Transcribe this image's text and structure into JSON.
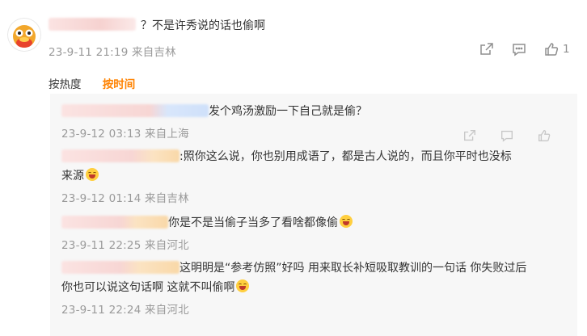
{
  "main_comment": {
    "text": "？不是许秀说的话也偷啊",
    "meta": "23-9-11 21:19 来自吉林",
    "likes": "1"
  },
  "sort_tabs": {
    "by_hot": "按热度",
    "by_time": "按时间"
  },
  "replies": [
    {
      "text": "发个鸡汤激励一下自己就是偷？",
      "meta": "23-9-12 03:13 来自上海"
    },
    {
      "text_line1": ":照你这么说，你也别用成语了，都是古人说的，而且你平时也没标",
      "text_line2": "来源",
      "meta": "23-9-12 01:14 来自吉林"
    },
    {
      "text": "你是不是当偷子当多了看啥都像偷",
      "meta": "23-9-11 22:25 来自河北"
    },
    {
      "text_line1": "这明明是“参考仿照”好吗 用来取长补短吸取教训的一句话 你失败过后",
      "text_line2": "你也可以说这句话啊 这就不叫偷啊",
      "meta": "23-9-11 22:24 来自河北"
    }
  ],
  "icons": {
    "share": "share-icon",
    "comment": "comment-icon",
    "like": "thumbs-up-icon",
    "emoji": "laughing-emoji-icon"
  }
}
